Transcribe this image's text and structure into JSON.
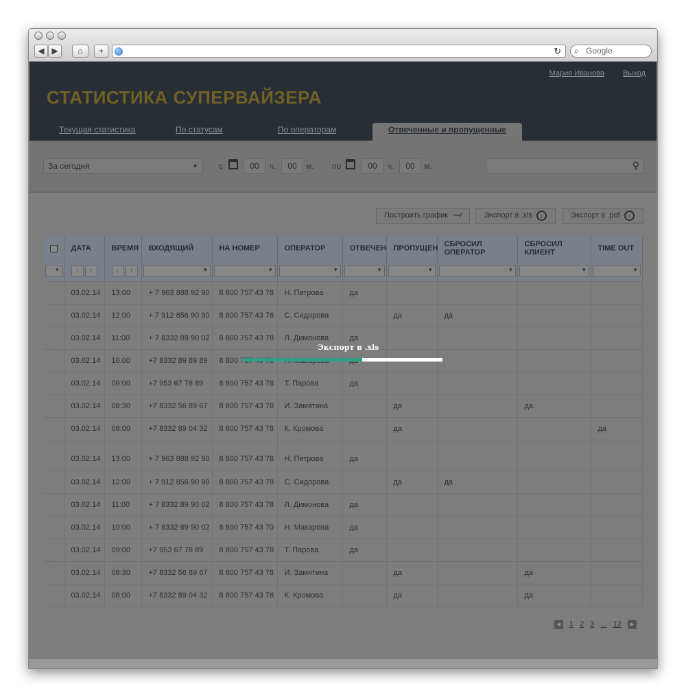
{
  "browser": {
    "search_placeholder": "Google"
  },
  "header": {
    "user": "Мария Иванова",
    "logout": "Выход",
    "title": "СТАТИСТИКА  СУПЕРВАЙЗЕРА",
    "tabs": [
      "Текущая статистика",
      "По статусам",
      "По операторам",
      "Отвеченные и пропущенные"
    ],
    "active_tab": 3
  },
  "filters": {
    "period": "За сегодня",
    "from_label": "с",
    "to_label": "по",
    "hours_label": "ч.",
    "minutes_label": "м.",
    "from_h": "00",
    "from_m": "00",
    "to_h": "00",
    "to_m": "00"
  },
  "actions": {
    "chart": "Построить график",
    "export_xls": "Экспорт в .xls",
    "export_pdf": "Экспорт в .pdf"
  },
  "table": {
    "headers": [
      "ДАТА",
      "ВРЕМЯ",
      "ВХОДЯЩИЙ",
      "НА НОМЕР",
      "ОПЕРАТОР",
      "ОТВЕЧЕН",
      "ПРОПУЩЕН",
      "СБРОСИЛ ОПЕРАТОР",
      "СБРОСИЛ КЛИЕНТ",
      "TIME OUT"
    ],
    "rows": [
      [
        "03.02.14",
        "13:00",
        "+ 7 963 888 92 90",
        "8 800 757 43 78",
        "Н. Петрова",
        "да",
        "",
        "",
        "",
        ""
      ],
      [
        "03.02.14",
        "12:00",
        "+ 7 912 856 90 90",
        "8 800 757 43 78",
        "С. Сидорова",
        "",
        "да",
        "да",
        "",
        ""
      ],
      [
        "03.02.14",
        "11:00",
        "+ 7 8332 89 90 02",
        "8 800 757 43 78",
        "Л. Димонова",
        "да",
        "",
        "",
        "",
        ""
      ],
      [
        "03.02.14",
        "10:00",
        "+7 8332 89 89 89",
        "8 800 757 43 70",
        "Н. Макарова",
        "да",
        "",
        "",
        "",
        ""
      ],
      [
        "03.02.14",
        "09:00",
        "+7 953 67 78 89",
        "8 800 757 43 78",
        "Т. Парова",
        "да",
        "",
        "",
        "",
        ""
      ],
      [
        "03.02.14",
        "08:30",
        "+7 8332 56 89 67",
        "8 800 757 43 78",
        "И. Замятина",
        "",
        "да",
        "",
        "да",
        ""
      ],
      [
        "03.02.14",
        "08:00",
        "+7 8332 89 04 32",
        "8 800 757 43 78",
        "К. Кромова",
        "",
        "да",
        "",
        "",
        "да"
      ],
      [
        "03.02.14",
        "13:00",
        "+ 7 963 888 92 90",
        "8 800 757 43 78",
        "Н. Петрова",
        "да",
        "",
        "",
        "",
        ""
      ],
      [
        "03.02.14",
        "12:00",
        "+ 7 912 856 90 90",
        "8 800 757 43 78",
        "С. Сидорова",
        "",
        "да",
        "да",
        "",
        ""
      ],
      [
        "03.02.14",
        "11:00",
        "+ 7 8332 89 90 02",
        "8 800 757 43 78",
        "Л. Димонова",
        "да",
        "",
        "",
        "",
        ""
      ],
      [
        "03.02.14",
        "10:00",
        "+ 7 8332 89 90 02",
        "8 800 757 43 70",
        "Н. Макарова",
        "да",
        "",
        "",
        "",
        ""
      ],
      [
        "03.02.14",
        "09:00",
        "+7 953 67 78 89",
        "8 800 757 43 78",
        "Т. Парова",
        "да",
        "",
        "",
        "",
        ""
      ],
      [
        "03.02.14",
        "08:30",
        "+7 8332 56 89 67",
        "8 800 757 43 78",
        "И. Замятина",
        "",
        "да",
        "",
        "да",
        ""
      ],
      [
        "03.02.14",
        "08:00",
        "+7 8332 89 04 32",
        "8 800 757 43 78",
        "К. Кромова",
        "",
        "да",
        "",
        "да",
        ""
      ]
    ]
  },
  "pager": {
    "pages": [
      "1",
      "2",
      "3",
      "...",
      "12"
    ]
  },
  "overlay": {
    "label": "Экспорт в .xls",
    "progress": 0.6
  }
}
